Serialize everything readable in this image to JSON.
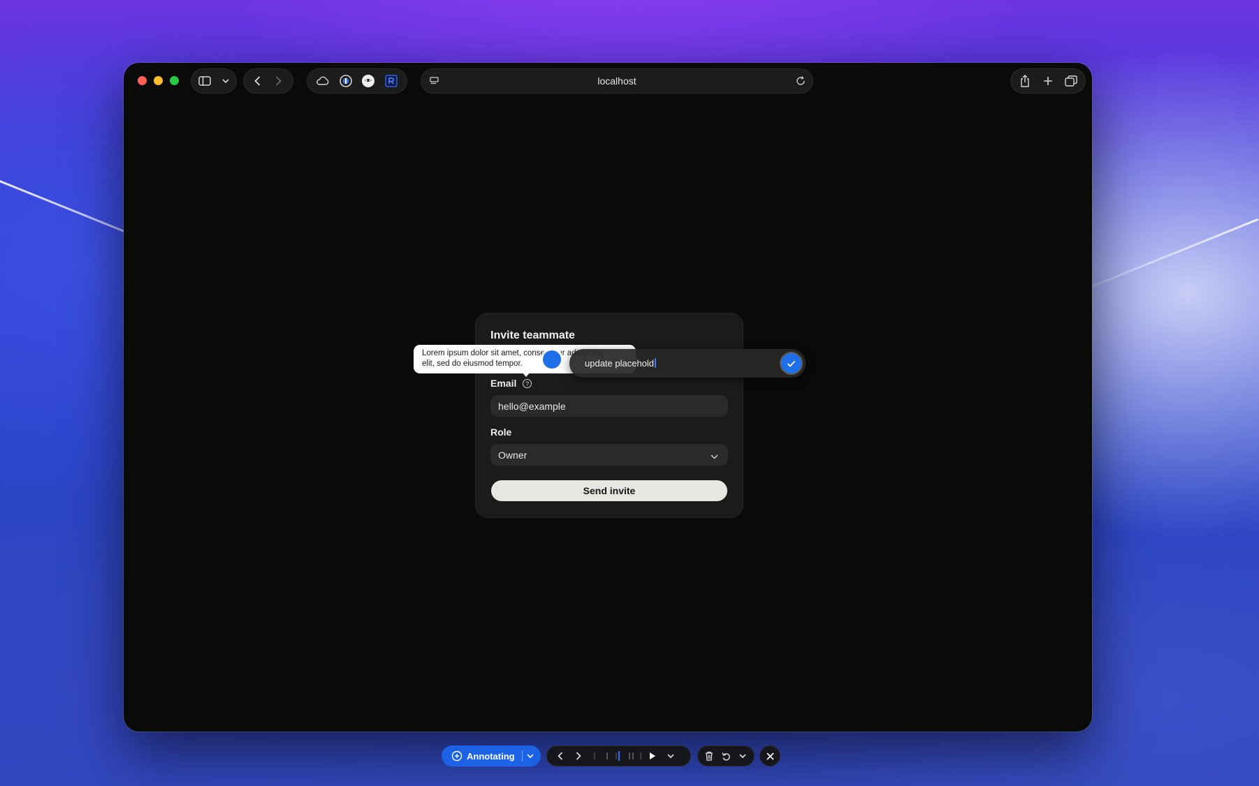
{
  "browser": {
    "address": "localhost"
  },
  "card": {
    "title": "Invite teammate",
    "email_label": "Email",
    "email_value": "hello@example",
    "role_label": "Role",
    "role_value": "Owner",
    "send_label": "Send invite"
  },
  "tooltip": {
    "line1": "Lorem ipsum dolor sit amet, consectetur adipiscing",
    "line2": "elit, sed do eiusmod tempor."
  },
  "annotation_editor": {
    "value": "update placehold"
  },
  "annotation_toolbar": {
    "mode_label": "Annotating"
  },
  "colors": {
    "accent": "#1f6fe8",
    "window_bg": "#0a0b09",
    "card_bg": "#1b1c1a"
  }
}
